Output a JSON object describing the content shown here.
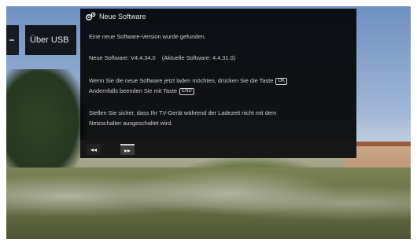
{
  "menu": {
    "item_label": "Über USB"
  },
  "dialog": {
    "title": "Neue Software",
    "line1": "Eine neue Software-Version wurde gefunden.",
    "new_sw_label": "Neue Software:",
    "new_sw_version": "V4.4.34.0",
    "current_sw_text": "(Aktuelle Software:",
    "current_sw_version": "4.4.31.0)",
    "line3a": "Wenn Sie die neue Software jetzt laden möchten, drücken Sie die Taste",
    "key1": "OK",
    "line3b": "Andernfalls beenden Sie mit Taste",
    "key2": "END",
    "line4a": "Stellen Sie sicher, dass Ihr TV-Gerät während der Ladezeit nicht mit dem",
    "line4b": "Netzschalter ausgeschaltet wird.",
    "btn_back_icon": "◂◂",
    "btn_next_icon": "▸▸"
  },
  "icons": {
    "dialog_icon": "gears-icon"
  }
}
